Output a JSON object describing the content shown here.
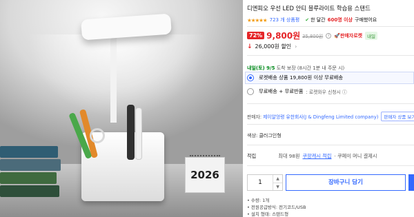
{
  "product": {
    "title": "디엔피오 우선 LED 안티 블루라이트 학습용 스탠드",
    "rating_stars": "★★★★★",
    "review_count": "723 개 상품평",
    "purchase_prefix": "한 달간",
    "purchase_count": "600명 이상",
    "purchase_suffix": "구매했어요"
  },
  "price": {
    "discount": "72%",
    "current": "9,800원",
    "original": "35,800원",
    "info_icon": "i",
    "rocket_seller": "판매자로켓",
    "tomorrow_badge": "내일",
    "coupon": "26,000원 할인",
    "coupon_caret": "›"
  },
  "delivery": {
    "date": "내일(토) 9/5",
    "info": "도착 보장 (8시간 1분 내 주문 시)",
    "option1": "로켓배송 상품 19,800원 이상 무료배송",
    "option2": "무료배송 + 무료반품",
    "option2_note": ": 로켓와우 신청시 ⓘ"
  },
  "seller": {
    "label": "판매자:",
    "name": "제이알엉령 유한회사(J & Dingfeng Limited company)",
    "more": "판매자 상품 보기"
  },
  "color": "색상: 클러그인형",
  "cashback": {
    "label": "적립",
    "max": "최대 98원",
    "link": "쿠팡캐시 적립",
    "rest": "· 쿠페이 머니 결제시"
  },
  "cart": {
    "quantity": "1",
    "qty_up": "▲",
    "qty_down": "▼",
    "add_to_cart": "장바구니 담기"
  },
  "notes": [
    "수량: 1개",
    "전원공급방식: 전기코드/USB",
    "설치 형태: 스탠드형"
  ],
  "image": {
    "calendar_year": "2026"
  },
  "colors": {
    "accent": "#346aff",
    "price_red": "#e52528",
    "star": "#f39c12",
    "delivery_green": "#00891a"
  }
}
